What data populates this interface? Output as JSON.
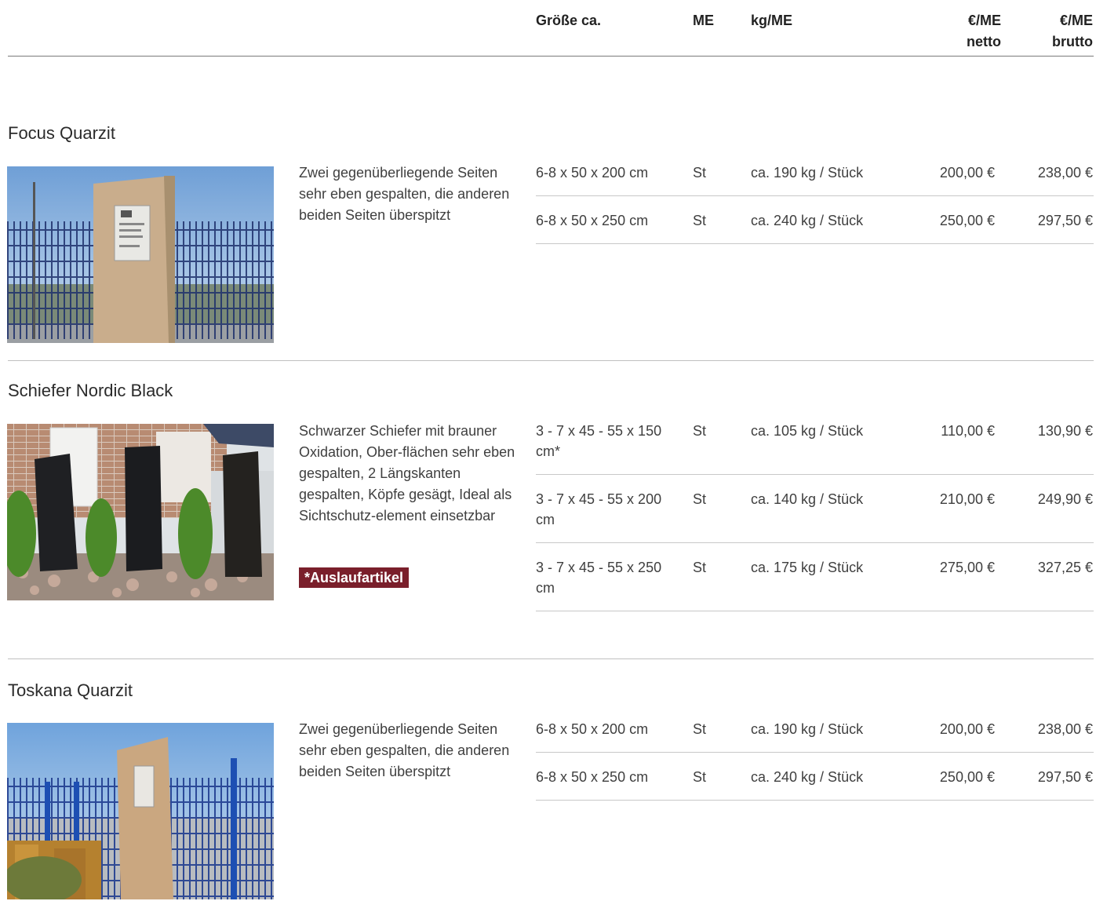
{
  "header": {
    "size": "Größe ca.",
    "unit": "ME",
    "weight": "kg/ME",
    "net_line1": "€/ME",
    "net_line2": "netto",
    "gross_line1": "€/ME",
    "gross_line2": "brutto"
  },
  "products": [
    {
      "title": "Focus Quarzit",
      "description": "Zwei gegenüberliegende Seiten sehr eben gespalten, die anderen beiden Seiten überspitzt",
      "rows": [
        {
          "size": "6-8 x 50 x 200 cm",
          "unit": "St",
          "weight": "ca. 190 kg / Stück",
          "net": "200,00 €",
          "gross": "238,00 €"
        },
        {
          "size": "6-8 x 50 x 250 cm",
          "unit": "St",
          "weight": "ca. 240 kg / Stück",
          "net": "250,00 €",
          "gross": "297,50 €"
        }
      ]
    },
    {
      "title": "Schiefer Nordic Black",
      "description": "Schwarzer Schiefer mit brauner Oxidation, Ober-flächen sehr eben gespalten, 2 Längskanten gespalten, Köpfe gesägt, Ideal als Sichtschutz-element einsetzbar",
      "badge": "*Auslaufartikel",
      "rows": [
        {
          "size": "3 - 7 x 45 - 55 x 150 cm*",
          "unit": "St",
          "weight": "ca. 105 kg / Stück",
          "net": "110,00 €",
          "gross": "130,90 €"
        },
        {
          "size": "3 - 7 x 45 - 55 x 200 cm",
          "unit": "St",
          "weight": "ca. 140 kg / Stück",
          "net": "210,00 €",
          "gross": "249,90 €"
        },
        {
          "size": "3 - 7 x 45 - 55 x 250 cm",
          "unit": "St",
          "weight": "ca. 175 kg / Stück",
          "net": "275,00 €",
          "gross": "327,25 €"
        }
      ]
    },
    {
      "title": "Toskana Quarzit",
      "description": "Zwei gegenüberliegende Seiten sehr eben gespalten, die anderen beiden Seiten überspitzt",
      "rows": [
        {
          "size": "6-8 x 50 x 200 cm",
          "unit": "St",
          "weight": "ca. 190 kg / Stück",
          "net": "200,00 €",
          "gross": "238,00 €"
        },
        {
          "size": "6-8 x 50 x 250 cm",
          "unit": "St",
          "weight": "ca. 240 kg / Stück",
          "net": "250,00 €",
          "gross": "297,50 €"
        }
      ]
    }
  ],
  "colors": {
    "badge_bg": "#7a1f2b",
    "rule": "#c8c8c8"
  }
}
